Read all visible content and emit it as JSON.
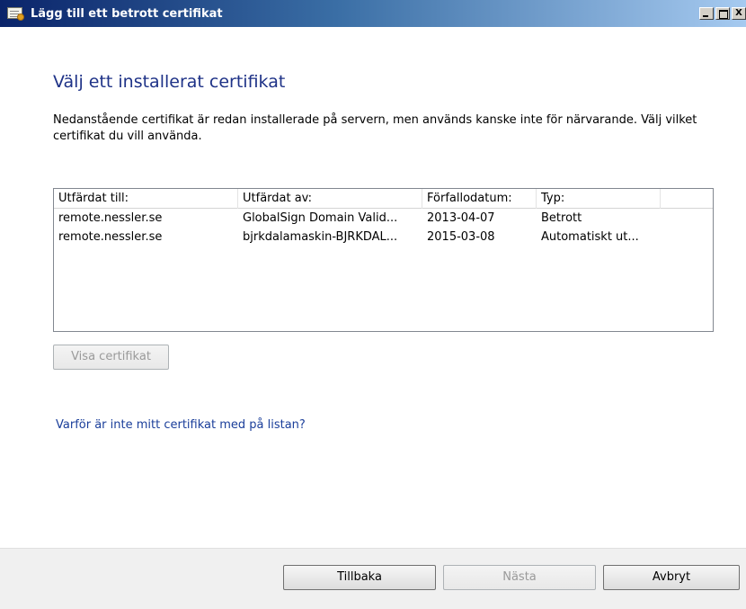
{
  "window": {
    "title": "Lägg till ett betrott certifikat",
    "icon": "certificate-icon",
    "close_label": "X"
  },
  "page": {
    "heading": "Välj ett installerat certifikat",
    "description": "Nedanstående certifikat är redan installerade på servern, men används kanske inte för närvarande. Välj vilket certifikat du vill använda."
  },
  "list": {
    "columns": [
      "Utfärdat till:",
      "Utfärdat av:",
      "Förfallodatum:",
      "Typ:"
    ],
    "rows": [
      [
        "remote.nessler.se",
        "GlobalSign Domain Valid...",
        "2013-04-07",
        "Betrott"
      ],
      [
        "remote.nessler.se",
        "bjrkdalamaskin-BJRKDAL...",
        "2015-03-08",
        "Automatiskt ut..."
      ]
    ]
  },
  "buttons": {
    "view_certificate": "Visa certifikat",
    "back": "Tillbaka",
    "next": "Nästa",
    "cancel": "Avbryt"
  },
  "help_link": "Varför är inte mitt certifikat med på listan?"
}
